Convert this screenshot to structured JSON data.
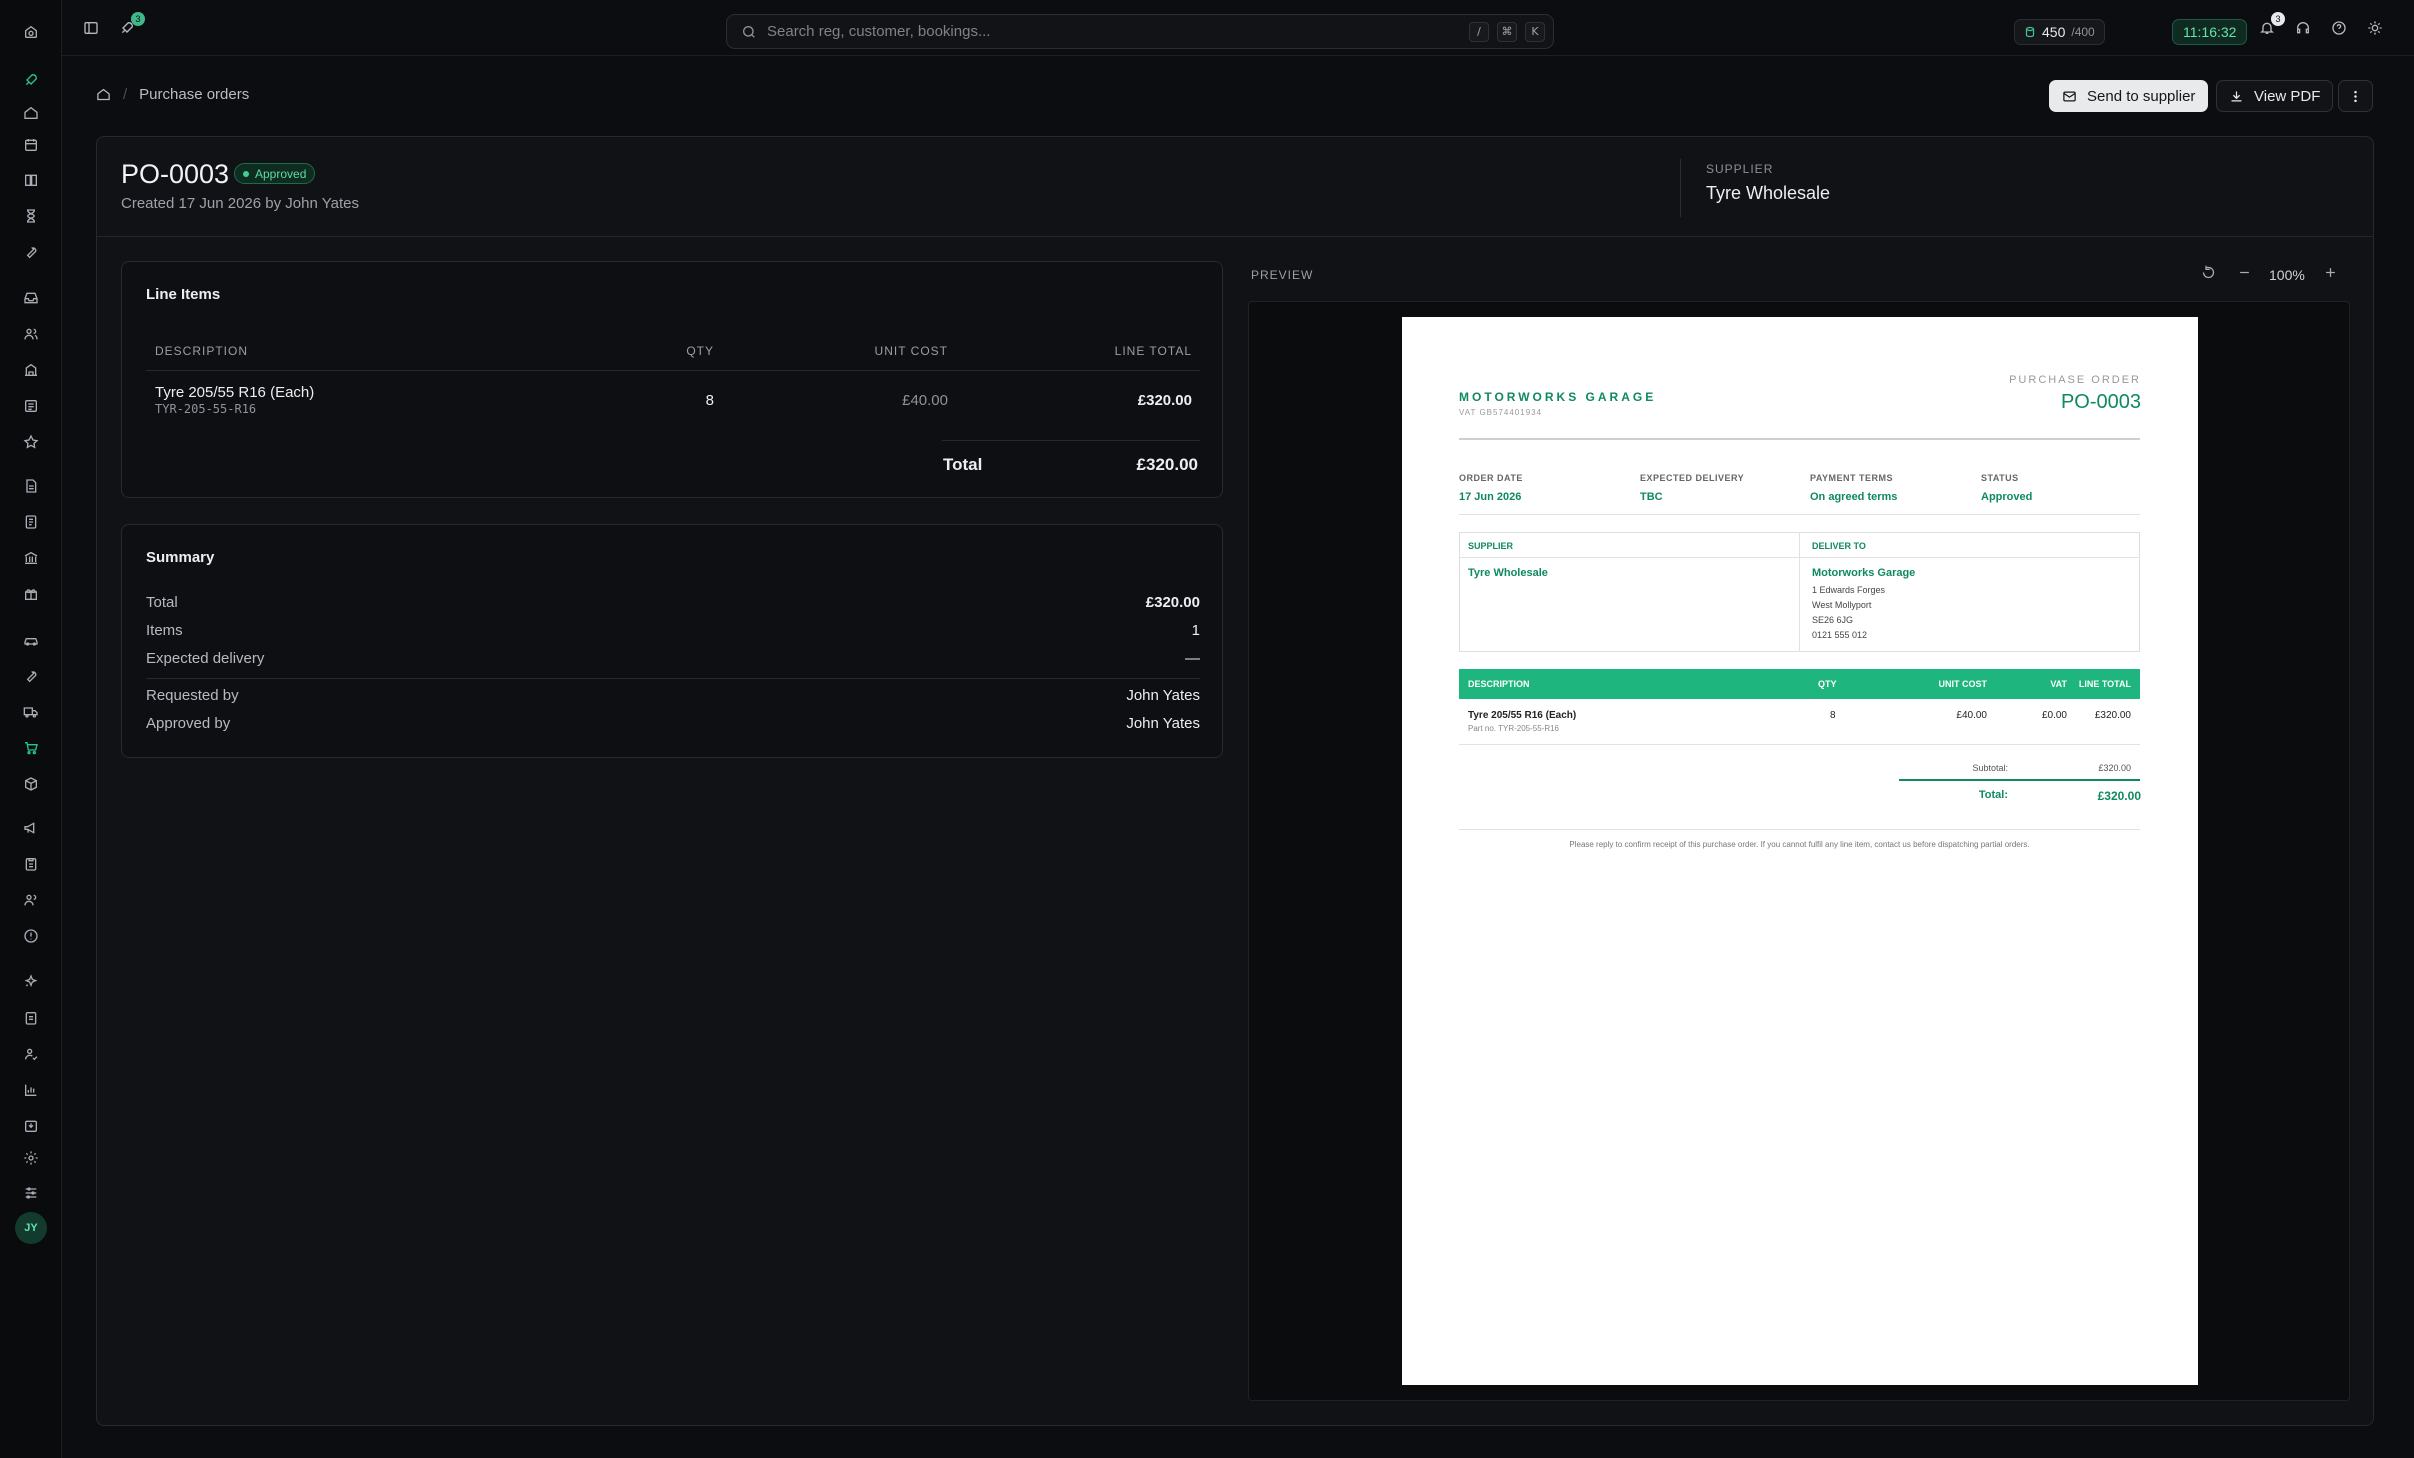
{
  "topbar": {
    "notification_badge": "3",
    "rocket_badge": "3",
    "search_placeholder": "Search reg, customer, bookings...",
    "shortcut_keys": [
      "/",
      "⌘",
      "K"
    ],
    "credits_value": "450",
    "credits_limit": "/400",
    "clock": "11:16:32"
  },
  "sidebar": {
    "icons": [
      "rocket-icon",
      "home-icon",
      "calendar-icon",
      "book-icon",
      "hourglass-icon",
      "wrench-icon",
      "inbox-icon",
      "users-icon",
      "building-icon",
      "invoice-icon",
      "star-icon",
      "document-icon",
      "receipt-icon",
      "bank-icon",
      "gift-icon",
      "car-icon",
      "tool-icon",
      "truck-icon",
      "cart-icon",
      "package-icon",
      "megaphone-icon",
      "clipboard-icon",
      "team-icon",
      "alert-icon",
      "puzzle-icon",
      "checklist-icon",
      "user-check-icon",
      "chart-icon",
      "inbox-down-icon",
      "settings-icon",
      "sliders-icon"
    ],
    "active": "cart-icon",
    "avatar_initials": "JY"
  },
  "breadcrumb": {
    "current": "Purchase orders"
  },
  "actions": {
    "send": "Send to supplier",
    "view_pdf": "View PDF"
  },
  "order": {
    "number": "PO-0003",
    "status": "Approved",
    "created": "Created 17 Jun 2026 by John Yates",
    "supplier_label": "SUPPLIER",
    "supplier_name": "Tyre Wholesale"
  },
  "line_items": {
    "title": "Line Items",
    "headers": {
      "description": "DESCRIPTION",
      "qty": "QTY",
      "unit_cost": "UNIT COST",
      "line_total": "LINE TOTAL"
    },
    "rows": [
      {
        "description": "Tyre 205/55 R16 (Each)",
        "sku": "TYR-205-55-R16",
        "qty": "8",
        "unit_cost": "£40.00",
        "line_total": "£320.00"
      }
    ],
    "total_label": "Total",
    "total_value": "£320.00"
  },
  "summary": {
    "title": "Summary",
    "rows": [
      {
        "label": "Total",
        "value": "£320.00"
      },
      {
        "label": "Items",
        "value": "1"
      },
      {
        "label": "Expected delivery",
        "value": "—"
      },
      {
        "label": "Requested by",
        "value": "John Yates"
      },
      {
        "label": "Approved by",
        "value": "John Yates"
      }
    ]
  },
  "preview": {
    "label": "PREVIEW",
    "zoom": "100%",
    "doc": {
      "company": "MOTORWORKS GARAGE",
      "vat": "VAT GB574401934",
      "doc_type": "PURCHASE ORDER",
      "number": "PO-0003",
      "meta": [
        {
          "label": "ORDER DATE",
          "value": "17 Jun 2026"
        },
        {
          "label": "EXPECTED DELIVERY",
          "value": "TBC"
        },
        {
          "label": "PAYMENT TERMS",
          "value": "On agreed terms"
        },
        {
          "label": "STATUS",
          "value": "Approved"
        }
      ],
      "supplier_label": "SUPPLIER",
      "supplier_name": "Tyre Wholesale",
      "deliver_label": "DELIVER TO",
      "deliver_name": "Motorworks Garage",
      "deliver_lines": [
        "1 Edwards Forges",
        "West Mollyport",
        "SE26 6JG",
        "0121 555 012"
      ],
      "table_headers": {
        "description": "DESCRIPTION",
        "qty": "QTY",
        "unit_cost": "UNIT COST",
        "vat": "VAT",
        "line_total": "LINE TOTAL"
      },
      "row": {
        "description": "Tyre 205/55 R16 (Each)",
        "part": "Part no. TYR-205-55-R16",
        "qty": "8",
        "unit_cost": "£40.00",
        "vat": "£0.00",
        "line_total": "£320.00"
      },
      "subtotal_label": "Subtotal:",
      "subtotal_value": "£320.00",
      "total_label": "Total:",
      "total_value": "£320.00",
      "footer": "Please reply to confirm receipt of this purchase order. If you cannot fulfil any line item, contact us before dispatching partial orders."
    }
  },
  "colors": {
    "accent": "#22c98a",
    "doc_green": "#0f8a5e",
    "doc_header": "#1fb57e",
    "background": "#0c0d10"
  }
}
